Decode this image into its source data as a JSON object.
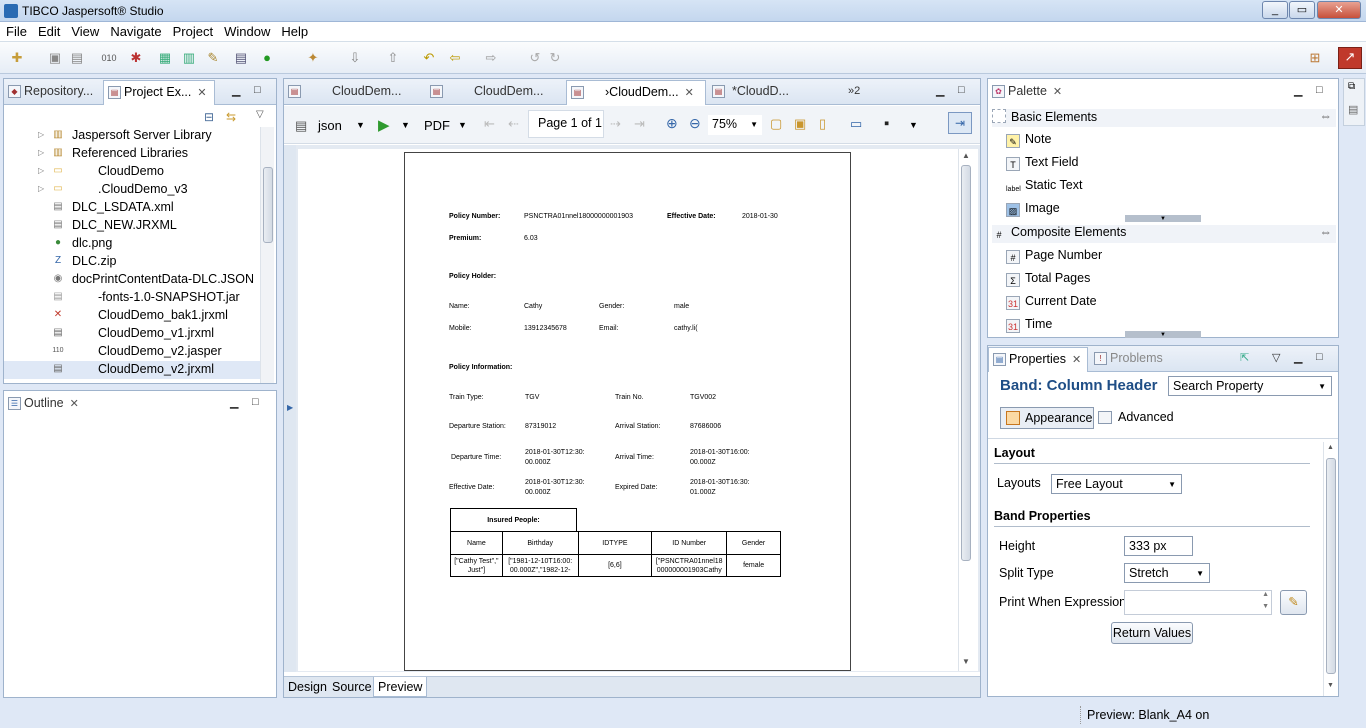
{
  "window": {
    "title": "TIBCO Jaspersoft® Studio",
    "min_icon": "minimize-icon",
    "max_icon": "maximize-icon",
    "close_icon": "close-icon"
  },
  "menu": [
    "File",
    "Edit",
    "View",
    "Navigate",
    "Project",
    "Window",
    "Help"
  ],
  "left_top": {
    "tabs": [
      {
        "label": "Repository..."
      },
      {
        "label": "Project Ex..."
      }
    ],
    "tree": [
      {
        "label": "Jaspersoft Server Library",
        "icon": "library-icon",
        "arrow": "▷"
      },
      {
        "label": "Referenced Libraries",
        "icon": "library-icon",
        "arrow": "▷"
      },
      {
        "label": "CloudDemo",
        "icon": "folder-icon",
        "arrow": "▷"
      },
      {
        "label": ".CloudDemo_v3",
        "icon": "folder-icon",
        "arrow": "▷"
      },
      {
        "label": "DLC_LSDATA.xml",
        "icon": "xml-file-icon",
        "arrow": ""
      },
      {
        "label": "DLC_NEW.JRXML",
        "icon": "file-icon",
        "arrow": ""
      },
      {
        "label": "dlc.png",
        "icon": "image-file-icon",
        "arrow": ""
      },
      {
        "label": "DLC.zip",
        "icon": "zip-file-icon",
        "arrow": ""
      },
      {
        "label": "docPrintContentData-DLC.JSON",
        "icon": "json-file-icon",
        "arrow": ""
      },
      {
        "label": "-fonts-1.0-SNAPSHOT.jar",
        "icon": "jar-file-icon",
        "arrow": ""
      },
      {
        "label": "CloudDemo_bak1.jrxml",
        "icon": "jrxml-error-icon",
        "arrow": ""
      },
      {
        "label": "CloudDemo_v1.jrxml",
        "icon": "jrxml-file-icon",
        "arrow": ""
      },
      {
        "label": "CloudDemo_v2.jasper",
        "icon": "jasper-file-icon",
        "arrow": ""
      },
      {
        "label": "CloudDemo_v2.jrxml",
        "icon": "jrxml-file-icon",
        "arrow": ""
      }
    ]
  },
  "outline": {
    "tab": "Outline"
  },
  "editor": {
    "tabs": [
      {
        "label": "CloudDem..."
      },
      {
        "label": "CloudDem..."
      },
      {
        "label": "›CloudDem..."
      },
      {
        "label": "*CloudD..."
      }
    ],
    "overflow": "»2",
    "toolbar": {
      "datasource": "json",
      "format": "PDF",
      "page": "Page 1 of 1",
      "zoom": "75%"
    },
    "bottom_tabs": [
      "Design",
      "Source",
      "Preview"
    ],
    "report": {
      "policy_number_label": "Policy Number:",
      "policy_number": "PSNCTRA01nnel18000000001903",
      "effective_date_label": "Effective Date:",
      "effective_date": "2018-01-30",
      "premium_label": "Premium:",
      "premium": "6.03",
      "policy_holder": "Policy Holder:",
      "name_label": "Name:",
      "name": "Cathy",
      "gender_label": "Gender:",
      "gender": "male",
      "mobile_label": "Mobile:",
      "mobile": "13912345678",
      "email_label": "Email:",
      "email": "cathy.li(",
      "policy_information": "Policy Information:",
      "train_type_label": "Train Type:",
      "train_type": "TGV",
      "train_no_label": "Train No.",
      "train_no": "TGV002",
      "departure_station_label": "Departure Station:",
      "departure_station": "87319012",
      "arrival_station_label": "Arrival Station:",
      "arrival_station": "87686006",
      "departure_time_label": "Departure Time:",
      "departure_time_1": "2018-01-30T12:30:",
      "departure_time_2": "00.000Z",
      "arrival_time_label": "Arrival Time:",
      "arrival_time_1": "2018-01-30T16:00:",
      "arrival_time_2": "00.000Z",
      "eff_date_label": "Effective Date:",
      "eff_date_1": "2018-01-30T12:30:",
      "eff_date_2": "00.000Z",
      "expired_date_label": "Expired Date:",
      "expired_date_1": "2018-01-30T16:30:",
      "expired_date_2": "01.000Z",
      "insured_people": "Insured People:",
      "headers": [
        "Name",
        "Birthday",
        "IDTYPE",
        "ID Number",
        "Gender"
      ],
      "row": [
        "[\"Cathy Test\",\" Just\"]",
        "[\"1981-12-10T16:00: 00.000Z\",\"1982-12-",
        "[6,6]",
        "[\"PSNCTRA01nnel18 000000001903Cathy",
        "female"
      ]
    }
  },
  "palette": {
    "tab": "Palette",
    "sections": [
      {
        "title": "Basic Elements",
        "items": [
          {
            "label": "Note",
            "icon": "note-icon"
          },
          {
            "label": "Text Field",
            "icon": "text-field-icon"
          },
          {
            "label": "Static Text",
            "icon": "static-text-icon"
          },
          {
            "label": "Image",
            "icon": "image-icon"
          }
        ]
      },
      {
        "title": "Composite Elements",
        "items": [
          {
            "label": "Page Number",
            "icon": "hash-icon"
          },
          {
            "label": "Total Pages",
            "icon": "sigma-icon"
          },
          {
            "label": "Current Date",
            "icon": "calendar-icon"
          },
          {
            "label": "Time",
            "icon": "calendar-icon"
          }
        ]
      }
    ]
  },
  "properties": {
    "tabs": [
      {
        "label": "Properties"
      },
      {
        "label": "Problems"
      }
    ],
    "title": "Band: Column Header",
    "search_placeholder": "Search Property",
    "subtabs": [
      {
        "label": "Appearance"
      },
      {
        "label": "Advanced"
      }
    ],
    "layout_section": "Layout",
    "layouts_label": "Layouts",
    "layouts_value": "Free Layout",
    "band_section": "Band Properties",
    "height_label": "Height",
    "height_value": "333 px",
    "split_label": "Split Type",
    "split_value": "Stretch",
    "print_when_label": "Print When Expression",
    "return_values": "Return Values"
  },
  "status": {
    "text": "Preview: Blank_A4 on"
  }
}
